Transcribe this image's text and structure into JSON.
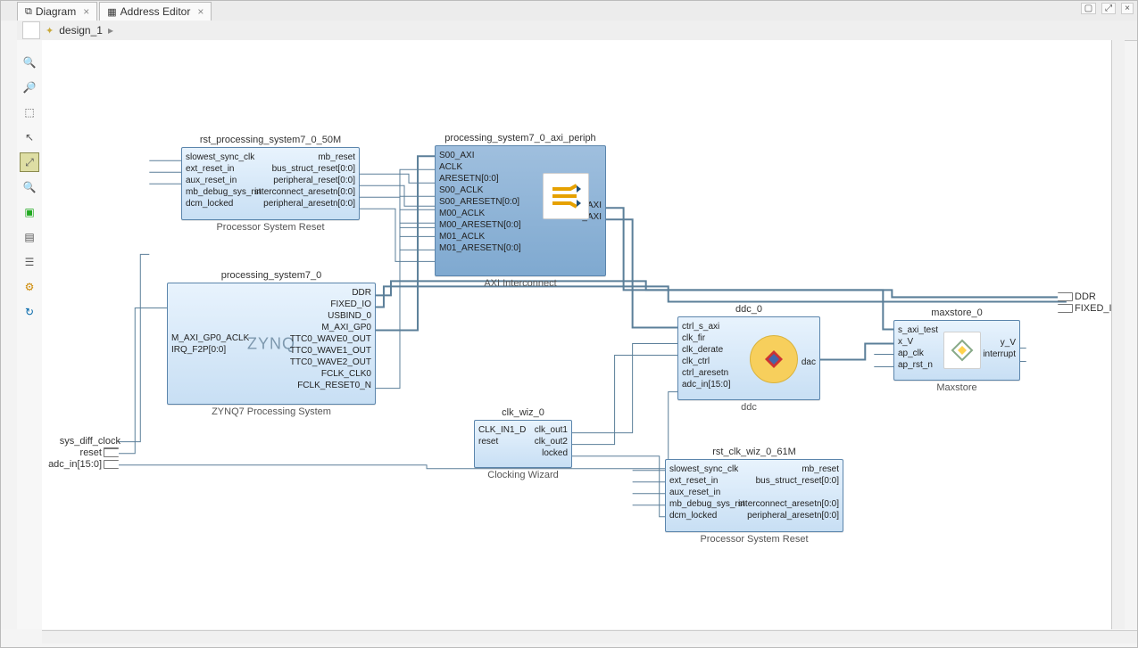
{
  "tabs": {
    "diagram": "Diagram",
    "address_editor": "Address Editor"
  },
  "breadcrumb": {
    "design_name": "design_1"
  },
  "toolbar": {
    "zoom_in": "zoom-in",
    "zoom_out": "zoom-out",
    "cursor": "cursor",
    "move": "fit-screen",
    "search": "search",
    "add_ip": "add-ip",
    "blocks": "ip",
    "chip": "validate",
    "gear": "settings",
    "refresh": "regenerate"
  },
  "external_ports": {
    "left": [
      {
        "name": "sys_diff_clock"
      },
      {
        "name": "reset"
      },
      {
        "name": "adc_in[15:0]"
      }
    ],
    "right": [
      {
        "name": "DDR"
      },
      {
        "name": "FIXED_IO"
      }
    ]
  },
  "blocks": {
    "rst50m": {
      "title": "rst_processing_system7_0_50M",
      "subtitle": "Processor System Reset",
      "left_ports": [
        "slowest_sync_clk",
        "ext_reset_in",
        "aux_reset_in",
        "mb_debug_sys_rst",
        "dcm_locked"
      ],
      "right_ports": [
        "mb_reset",
        "bus_struct_reset[0:0]",
        "peripheral_reset[0:0]",
        "interconnect_aresetn[0:0]",
        "peripheral_aresetn[0:0]"
      ]
    },
    "axi": {
      "title": "processing_system7_0_axi_periph",
      "subtitle": "AXI Interconnect",
      "left_ports": [
        "S00_AXI",
        "ACLK",
        "ARESETN[0:0]",
        "S00_ACLK",
        "S00_ARESETN[0:0]",
        "M00_ACLK",
        "M00_ARESETN[0:0]",
        "M01_ACLK",
        "M01_ARESETN[0:0]"
      ],
      "right_ports": [
        "M00_AXI",
        "M01_AXI"
      ]
    },
    "ps7": {
      "title": "processing_system7_0",
      "subtitle": "ZYNQ7 Processing System",
      "center": "ZYNQ",
      "left_ports": [
        "M_AXI_GP0_ACLK",
        "IRQ_F2P[0:0]"
      ],
      "right_ports": [
        "DDR",
        "FIXED_IO",
        "USBIND_0",
        "M_AXI_GP0",
        "TTC0_WAVE0_OUT",
        "TTC0_WAVE1_OUT",
        "TTC0_WAVE2_OUT",
        "FCLK_CLK0",
        "FCLK_RESET0_N"
      ]
    },
    "clkwiz": {
      "title": "clk_wiz_0",
      "subtitle": "Clocking Wizard",
      "left_ports": [
        "CLK_IN1_D",
        "reset"
      ],
      "right_ports": [
        "clk_out1",
        "clk_out2",
        "locked"
      ]
    },
    "rst61m": {
      "title": "rst_clk_wiz_0_61M",
      "subtitle": "Processor System Reset",
      "left_ports": [
        "slowest_sync_clk",
        "ext_reset_in",
        "aux_reset_in",
        "mb_debug_sys_rst",
        "dcm_locked"
      ],
      "right_ports": [
        "mb_reset",
        "bus_struct_reset[0:0]",
        "peripheral_reset[0:0]",
        "interconnect_aresetn[0:0]",
        "peripheral_aresetn[0:0]"
      ]
    },
    "ddc": {
      "title": "ddc_0",
      "subtitle": "ddc",
      "left_ports": [
        "ctrl_s_axi",
        "clk_fir",
        "clk_derate",
        "clk_ctrl",
        "ctrl_aresetn",
        "adc_in[15:0]"
      ],
      "right_ports": [
        "dac"
      ]
    },
    "maxstore": {
      "title": "maxstore_0",
      "subtitle": "Maxstore",
      "left_ports": [
        "s_axi_test",
        "x_V",
        "ap_clk",
        "ap_rst_n"
      ],
      "right_ports": [
        "y_V",
        "interrupt"
      ]
    }
  }
}
